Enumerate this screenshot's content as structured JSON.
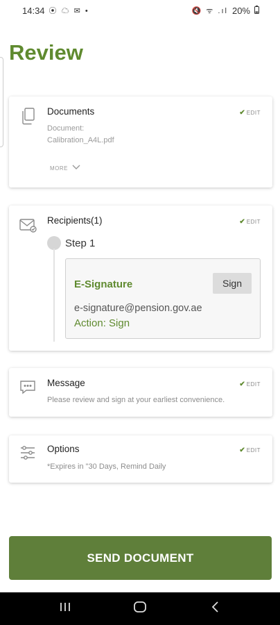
{
  "status_bar": {
    "time": "14:34",
    "left_icons": "⦿ ☁ ✉ •",
    "right_icons": "🔇 ᯤ .ıl",
    "battery": "20%"
  },
  "page": {
    "title": "Review"
  },
  "edit_label": "EDIT",
  "documents": {
    "title": "Documents",
    "doc_label": "Document:",
    "doc_name": "Calibration_A4L.pdf",
    "more_label": "MORE"
  },
  "recipients": {
    "title": "Recipients(1)",
    "step_label": "Step 1",
    "signer": {
      "role": "E-Signature",
      "button_label": "Sign",
      "email": "e-signature@pension.gov.ae",
      "action": "Action: Sign"
    }
  },
  "message": {
    "title": "Message",
    "text": "Please review and sign at your earliest convenience."
  },
  "options": {
    "title": "Options",
    "text": "*Expires in \"30 Days, Remind Daily"
  },
  "send_button": {
    "label": "SEND DOCUMENT"
  },
  "colors": {
    "accent": "#5f8a2f",
    "button": "#5f7f3a",
    "nav_bar": "#000000"
  }
}
